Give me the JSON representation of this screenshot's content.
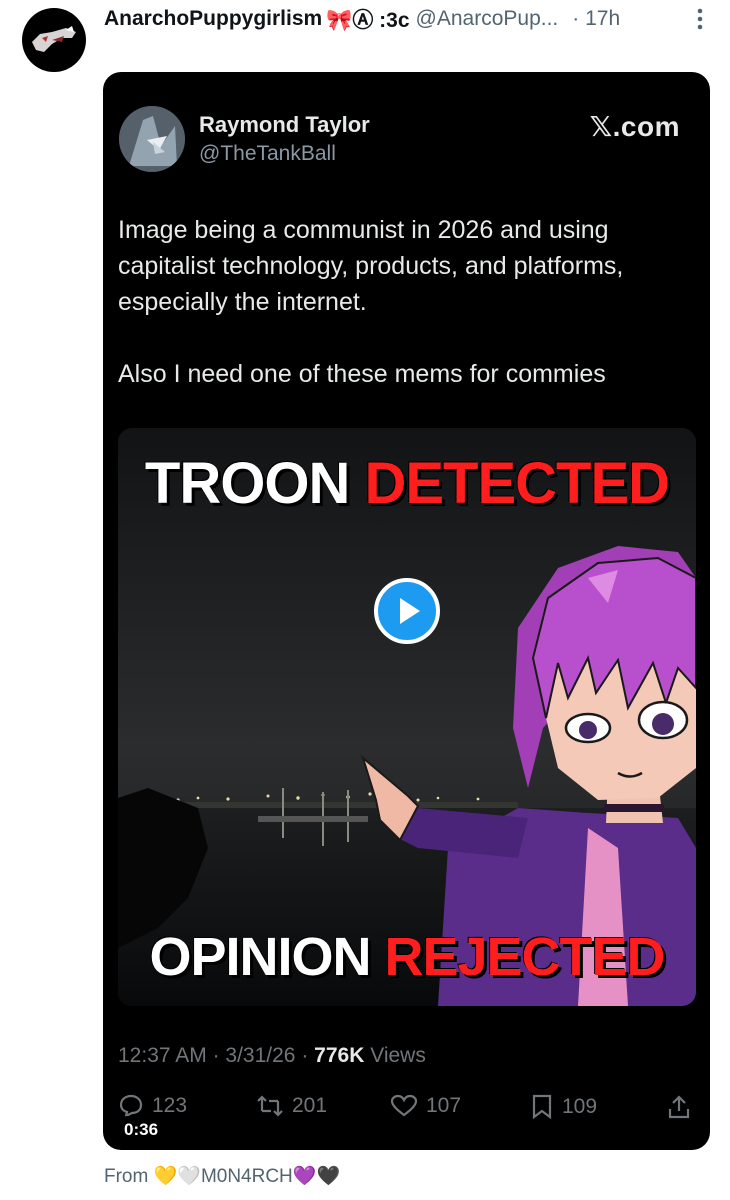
{
  "post": {
    "display_name": "AnarchoPuppygirlism",
    "name_suffix": "🎀Ⓐ :3c",
    "handle": "@AnarcoPup...",
    "time": "· 17h"
  },
  "embedded": {
    "name": "Raymond Taylor",
    "handle": "@TheTankBall",
    "brand": "𝕏.com",
    "text": "Image being a communist in 2026 and using\ncapitalist technology, products, and platforms,\nespecially the internet.\n\nAlso I need one of these mems for commies",
    "meme": {
      "top_white": "TROON",
      "top_red": "DETECTED",
      "bottom_white": "OPINION",
      "bottom_red": "REJECTED"
    },
    "meta": {
      "time": "12:37 AM",
      "date": "3/31/26",
      "views_count": "776K",
      "views_label": "Views"
    },
    "actions": {
      "replies": "123",
      "reposts": "201",
      "likes": "107",
      "bookmarks": "109"
    },
    "duration": "0:36"
  },
  "footer": {
    "prefix": "From",
    "emoji_a": "💛🤍",
    "name": "M0N4RCH",
    "emoji_b": "💜🖤"
  },
  "colors": {
    "accent_blue": "#1d9bf0",
    "meme_red": "#ff1e1e",
    "card_bg": "#000000"
  }
}
